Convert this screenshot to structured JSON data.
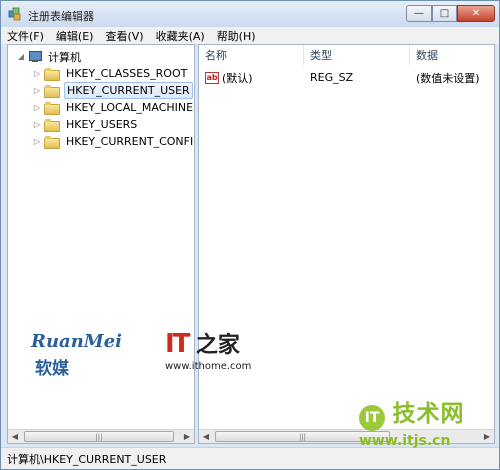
{
  "window": {
    "title": "注册表编辑器",
    "controls": {
      "minimize": "—",
      "maximize": "□",
      "close": "✕"
    }
  },
  "menu": [
    {
      "label": "文件(F)"
    },
    {
      "label": "编辑(E)"
    },
    {
      "label": "查看(V)"
    },
    {
      "label": "收藏夹(A)"
    },
    {
      "label": "帮助(H)"
    }
  ],
  "tree": {
    "root": "计算机",
    "keys": [
      {
        "label": "HKEY_CLASSES_ROOT",
        "selected": false
      },
      {
        "label": "HKEY_CURRENT_USER",
        "selected": true
      },
      {
        "label": "HKEY_LOCAL_MACHINE",
        "selected": false
      },
      {
        "label": "HKEY_USERS",
        "selected": false
      },
      {
        "label": "HKEY_CURRENT_CONFIG",
        "selected": false
      }
    ]
  },
  "list": {
    "columns": [
      "名称",
      "类型",
      "数据"
    ],
    "rows": [
      {
        "name": "(默认)",
        "type": "REG_SZ",
        "data": "(数值未设置)",
        "icon": "ab"
      }
    ]
  },
  "statusbar": {
    "path": "计算机\\HKEY_CURRENT_USER"
  },
  "watermarks": {
    "ruanmei_latin": "RuanMei",
    "ruanmei_cjk": "软媒",
    "ithome_logo": "IT",
    "ithome_zhi": "之家",
    "ithome_url": "www.ithome.com",
    "itjs_badge": "IT",
    "itjs_text": "技术网",
    "itjs_url": "www.itjs.cn"
  },
  "colors": {
    "accent": "#2b5f9a",
    "ithome_red": "#d02a1f",
    "itjs_green": "#8bbd2a",
    "selection": "#dceafc"
  }
}
